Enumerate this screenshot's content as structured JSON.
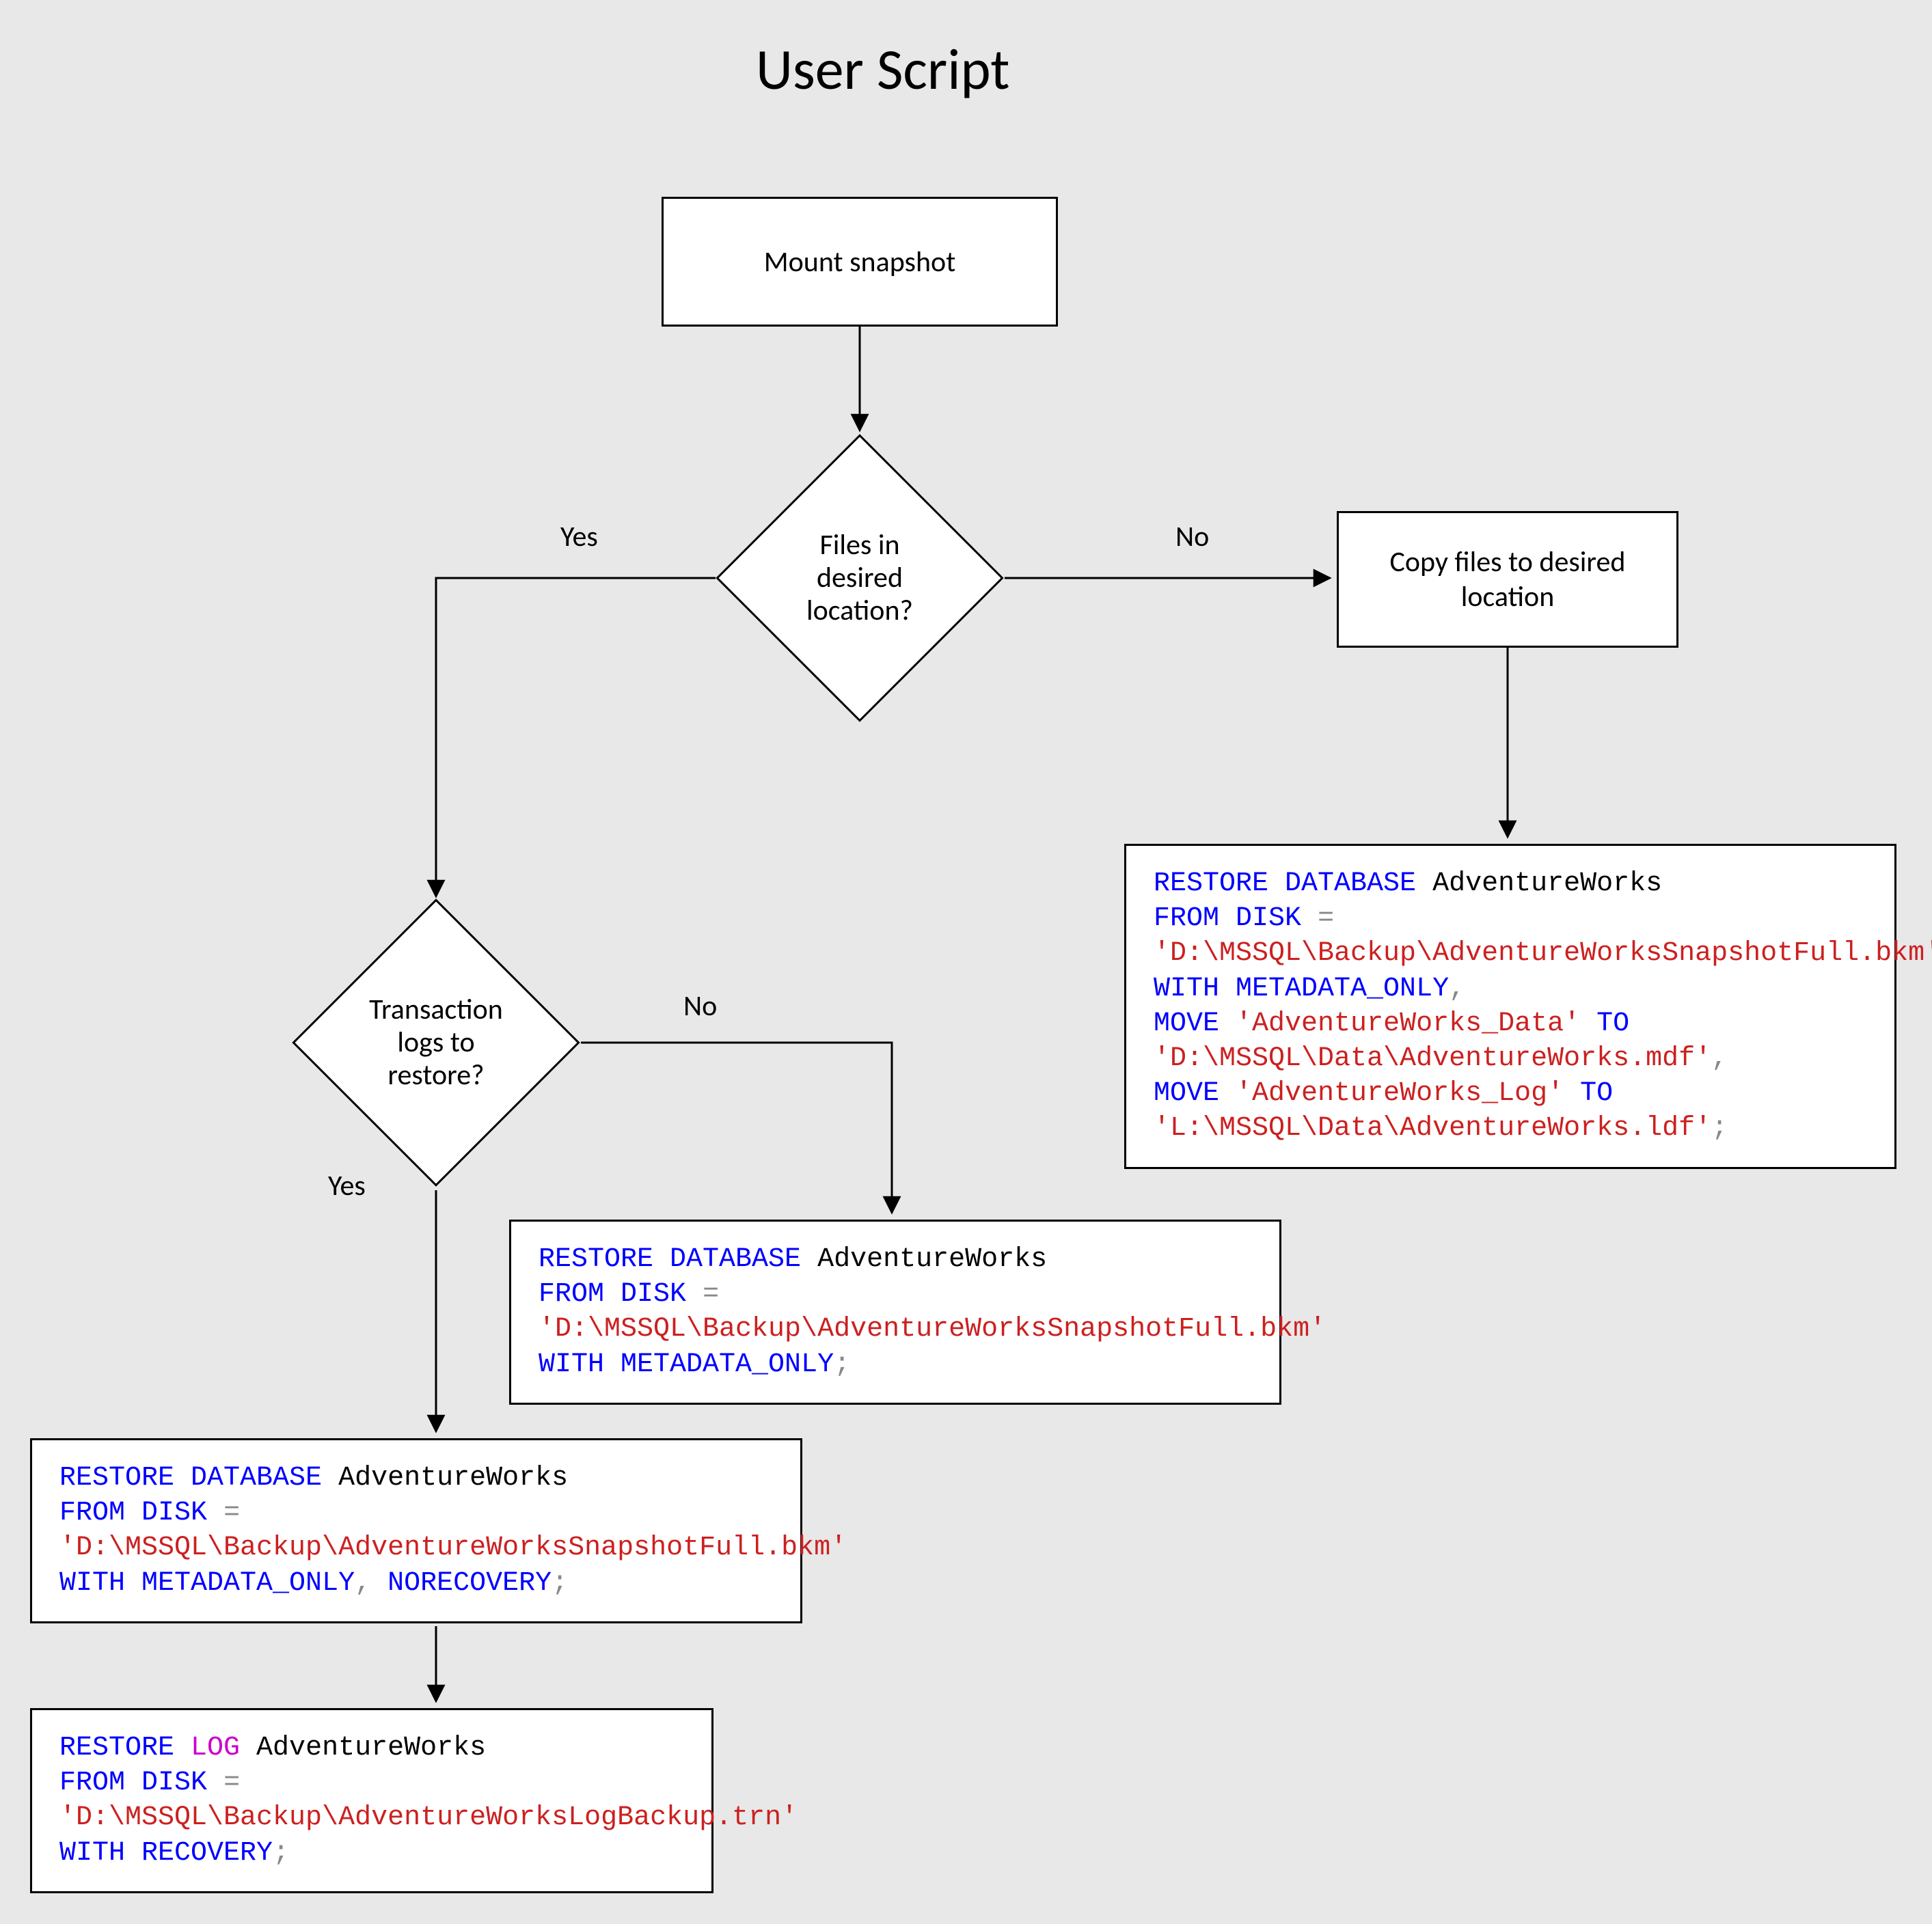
{
  "title": "User Script",
  "nodes": {
    "mount": "Mount snapshot",
    "decision_files": "Files in\ndesired\nlocation?",
    "copy_files": "Copy files to desired\nlocation",
    "decision_tx": "Transaction\nlogs to\nrestore?"
  },
  "labels": {
    "yes1": "Yes",
    "no1": "No",
    "yes2": "Yes",
    "no2": "No"
  },
  "code": {
    "right": [
      {
        "cls": "kw",
        "t": "RESTORE DATABASE"
      },
      {
        "cls": "id",
        "t": " AdventureWorks\n"
      },
      {
        "cls": "kw",
        "t": "FROM DISK"
      },
      {
        "cls": "id",
        "t": " "
      },
      {
        "cls": "gray",
        "t": "=\n"
      },
      {
        "cls": "str",
        "t": "'D:\\MSSQL\\Backup\\AdventureWorksSnapshotFull.bkm'\n"
      },
      {
        "cls": "kw",
        "t": "WITH METADATA_ONLY"
      },
      {
        "cls": "gray",
        "t": ",\n"
      },
      {
        "cls": "kw",
        "t": "MOVE"
      },
      {
        "cls": "id",
        "t": " "
      },
      {
        "cls": "str",
        "t": "'AdventureWorks_Data'"
      },
      {
        "cls": "id",
        "t": " "
      },
      {
        "cls": "kw",
        "t": "TO"
      },
      {
        "cls": "id",
        "t": "\n"
      },
      {
        "cls": "str",
        "t": "'D:\\MSSQL\\Data\\AdventureWorks.mdf'"
      },
      {
        "cls": "gray",
        "t": ",\n"
      },
      {
        "cls": "kw",
        "t": "MOVE"
      },
      {
        "cls": "id",
        "t": " "
      },
      {
        "cls": "str",
        "t": "'AdventureWorks_Log'"
      },
      {
        "cls": "id",
        "t": " "
      },
      {
        "cls": "kw",
        "t": "TO"
      },
      {
        "cls": "id",
        "t": "\n"
      },
      {
        "cls": "str",
        "t": "'L:\\MSSQL\\Data\\AdventureWorks.ldf'"
      },
      {
        "cls": "gray",
        "t": ";"
      }
    ],
    "mid": [
      {
        "cls": "kw",
        "t": "RESTORE DATABASE"
      },
      {
        "cls": "id",
        "t": " AdventureWorks\n"
      },
      {
        "cls": "kw",
        "t": "FROM DISK"
      },
      {
        "cls": "id",
        "t": " "
      },
      {
        "cls": "gray",
        "t": "=\n"
      },
      {
        "cls": "str",
        "t": "'D:\\MSSQL\\Backup\\AdventureWorksSnapshotFull.bkm'\n"
      },
      {
        "cls": "kw",
        "t": "WITH METADATA_ONLY"
      },
      {
        "cls": "gray",
        "t": ";"
      }
    ],
    "bottom1": [
      {
        "cls": "kw",
        "t": "RESTORE DATABASE"
      },
      {
        "cls": "id",
        "t": " AdventureWorks\n"
      },
      {
        "cls": "kw",
        "t": "FROM DISK"
      },
      {
        "cls": "id",
        "t": " "
      },
      {
        "cls": "gray",
        "t": "=\n"
      },
      {
        "cls": "str",
        "t": "'D:\\MSSQL\\Backup\\AdventureWorksSnapshotFull.bkm'\n"
      },
      {
        "cls": "kw",
        "t": "WITH METADATA_ONLY"
      },
      {
        "cls": "gray",
        "t": ", "
      },
      {
        "cls": "kw",
        "t": "NORECOVERY"
      },
      {
        "cls": "gray",
        "t": ";"
      }
    ],
    "bottom2": [
      {
        "cls": "kw",
        "t": "RESTORE "
      },
      {
        "cls": "mag",
        "t": "LOG"
      },
      {
        "cls": "id",
        "t": " AdventureWorks\n"
      },
      {
        "cls": "kw",
        "t": "FROM DISK"
      },
      {
        "cls": "id",
        "t": " "
      },
      {
        "cls": "gray",
        "t": "=\n"
      },
      {
        "cls": "str",
        "t": "'D:\\MSSQL\\Backup\\AdventureWorksLogBackup.trn'\n"
      },
      {
        "cls": "kw",
        "t": "WITH RECOVERY"
      },
      {
        "cls": "gray",
        "t": ";"
      }
    ]
  }
}
